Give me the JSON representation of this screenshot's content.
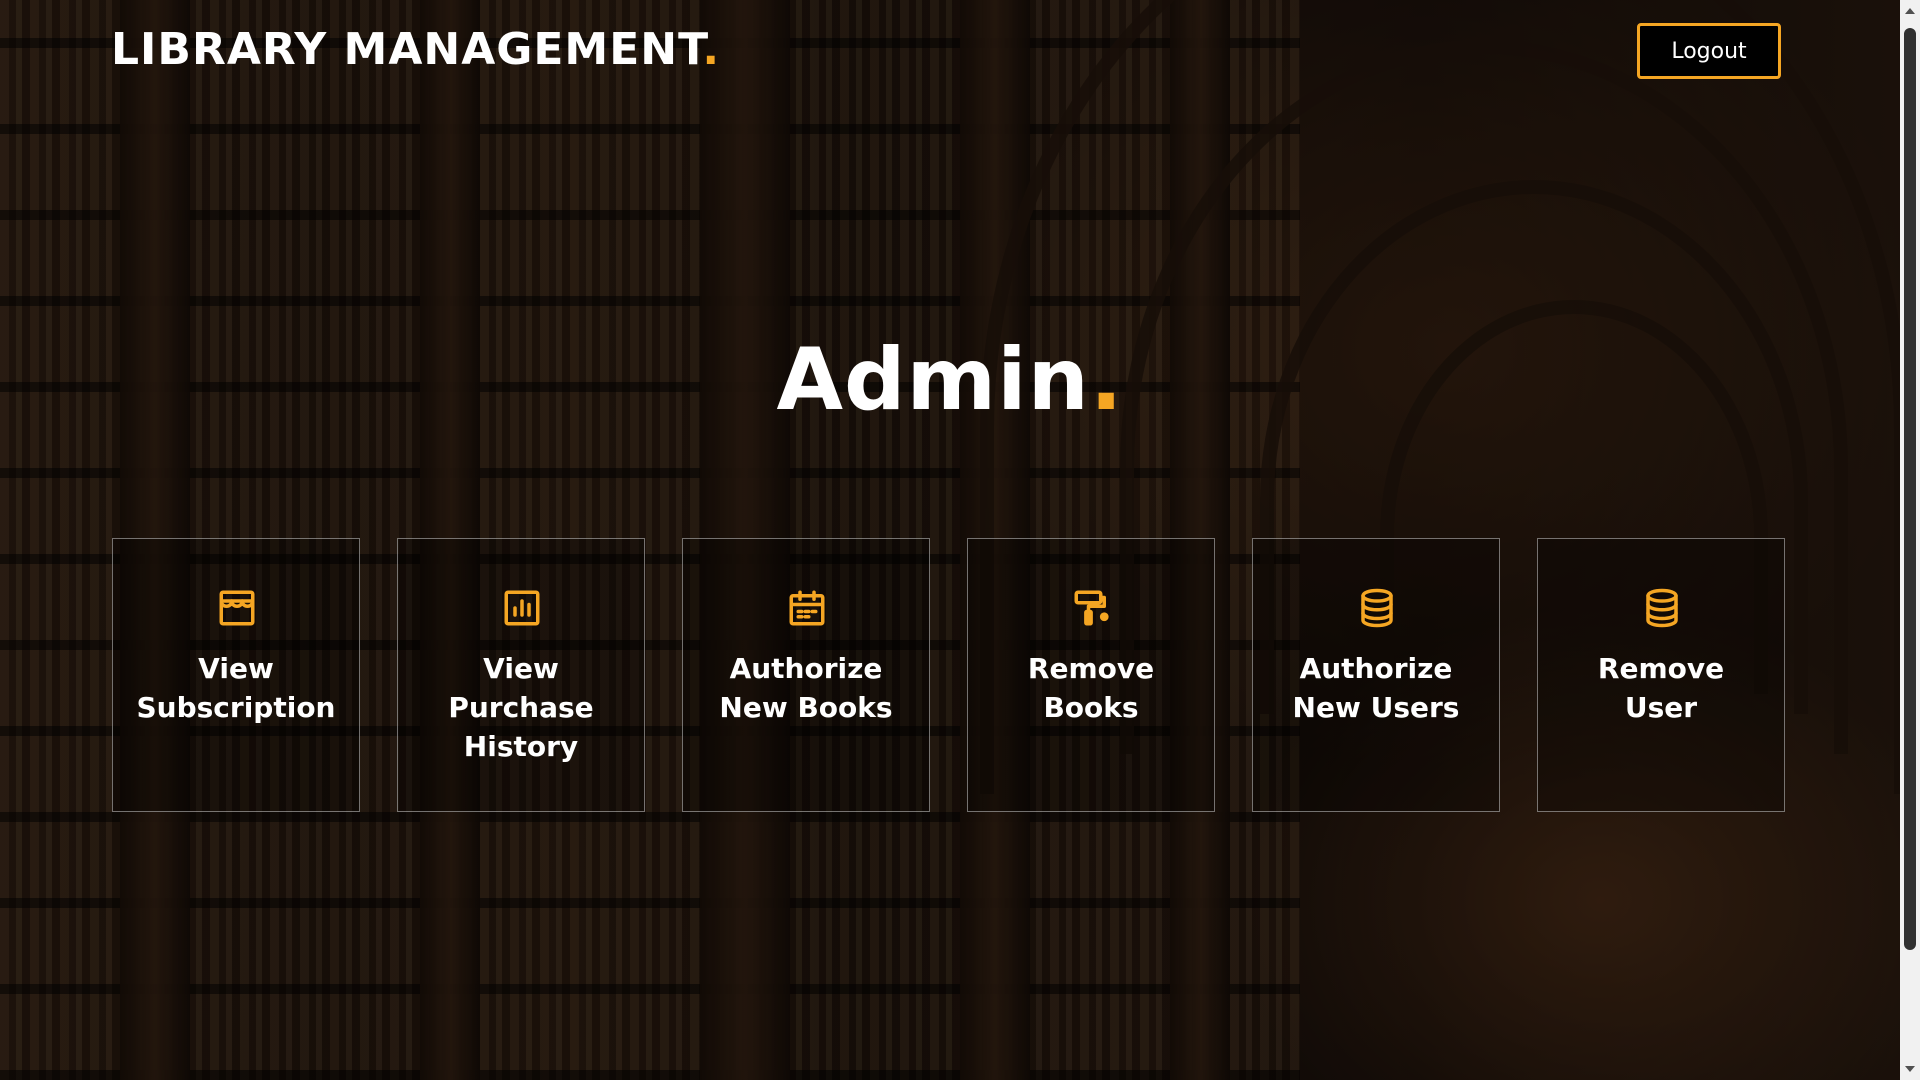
{
  "header": {
    "brand_text": "LIBRARY MANAGEMENT",
    "brand_dot": ".",
    "logout_label": "Logout"
  },
  "main": {
    "title_text": "Admin",
    "title_dot": "."
  },
  "cards": [
    {
      "line1": "View",
      "line2": "Subscription",
      "line3": "",
      "icon": "store-icon"
    },
    {
      "line1": "View",
      "line2": "Purchase",
      "line3": "History",
      "icon": "bar-chart-icon"
    },
    {
      "line1": "Authorize",
      "line2": "New Books",
      "line3": "",
      "icon": "calendar-icon"
    },
    {
      "line1": "Remove",
      "line2": "Books",
      "line3": "",
      "icon": "paint-roller-icon"
    },
    {
      "line1": "Authorize",
      "line2": "New Users",
      "line3": "",
      "icon": "database-icon"
    },
    {
      "line1": "Remove",
      "line2": "User",
      "line3": "",
      "icon": "database-icon"
    }
  ],
  "colors": {
    "accent": "#f5a623",
    "text": "#ffffff",
    "logout_bg": "#000000"
  }
}
